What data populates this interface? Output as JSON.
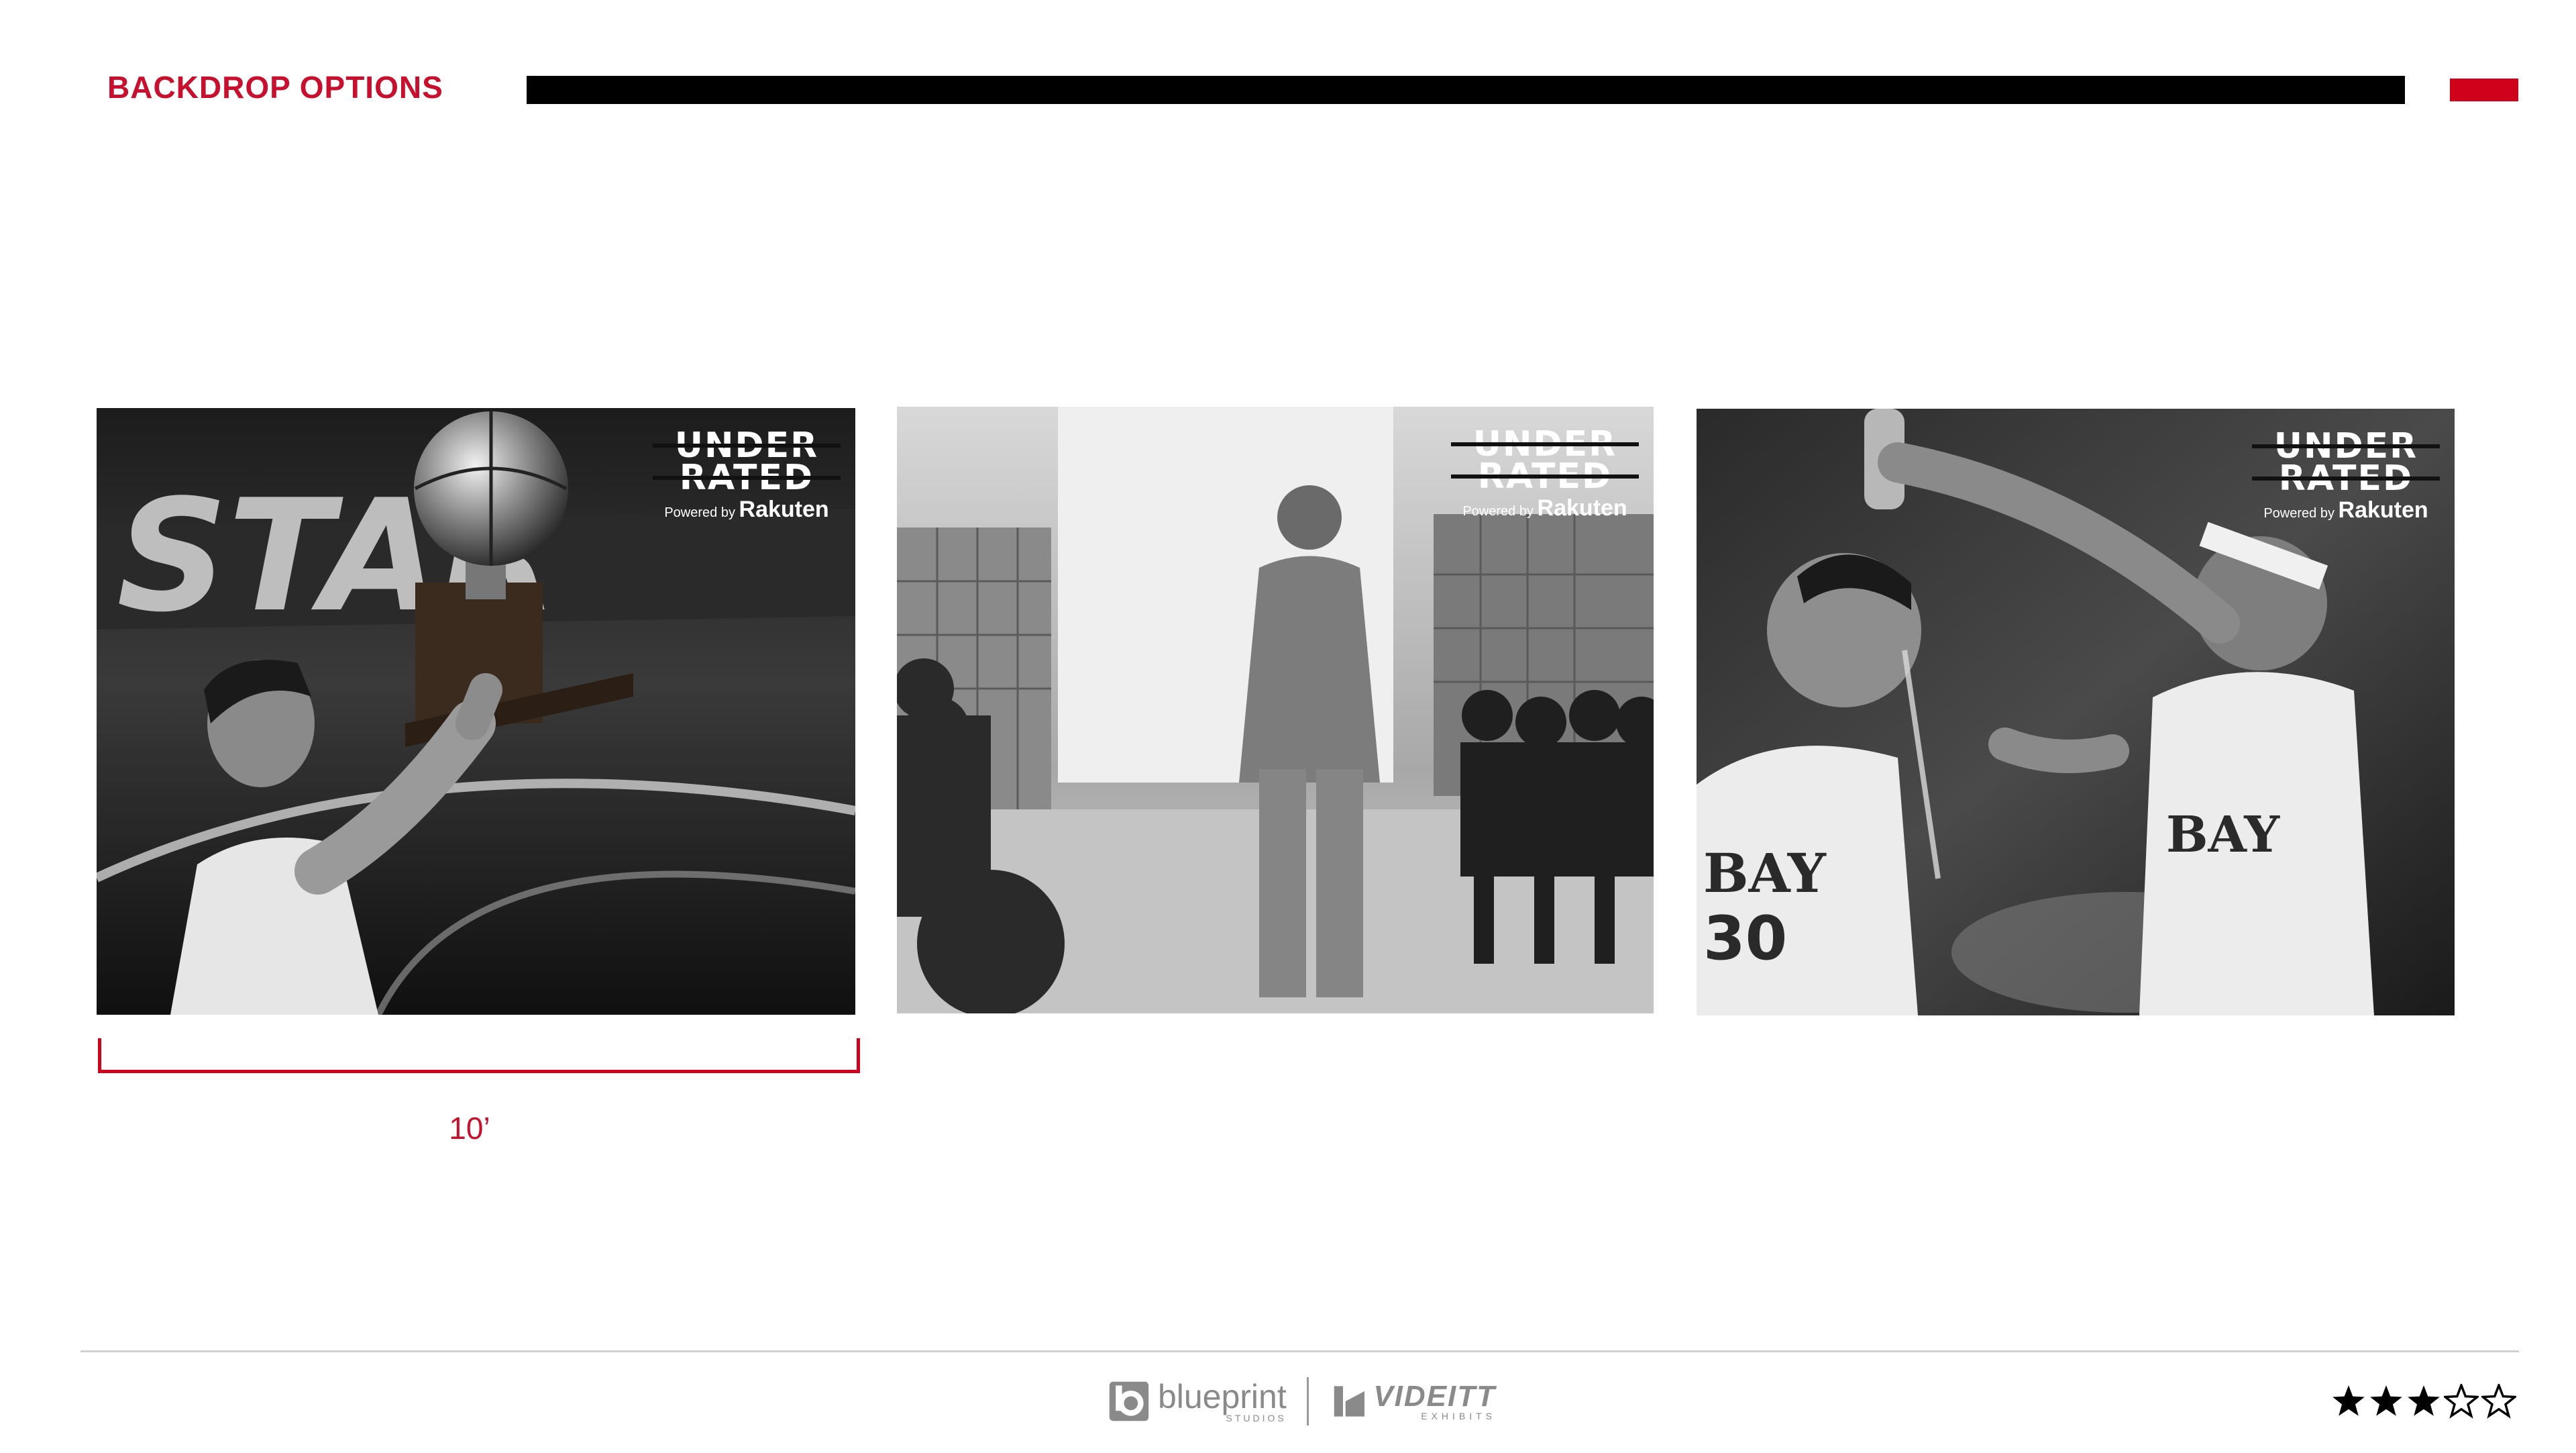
{
  "header": {
    "title": "BACKDROP OPTIONS",
    "accent_color": "#c8102e"
  },
  "photos": [
    {
      "label": "Photo option 1 - player lifting trophy",
      "logo": {
        "line1": "UNDER",
        "line2": "RATED",
        "powered_by": "Powered by",
        "brand": "Rakuten"
      }
    },
    {
      "label": "Photo option 2 - player walking through locker room",
      "logo": {
        "line1": "UNDER",
        "line2": "RATED",
        "powered_by": "Powered by",
        "brand": "Rakuten"
      }
    },
    {
      "label": "Photo option 3 - teammates celebrating with water",
      "logo": {
        "line1": "UNDER",
        "line2": "RATED",
        "powered_by": "Powered by",
        "brand": "Rakuten"
      }
    }
  ],
  "dimension": {
    "label": "10’"
  },
  "footer": {
    "logo1": {
      "main": "blueprint",
      "sub": "STUDIOS"
    },
    "logo2": {
      "main": "VIDEITT",
      "sub": "EXHIBITS"
    },
    "rating": {
      "filled": 3,
      "total": 5
    }
  }
}
